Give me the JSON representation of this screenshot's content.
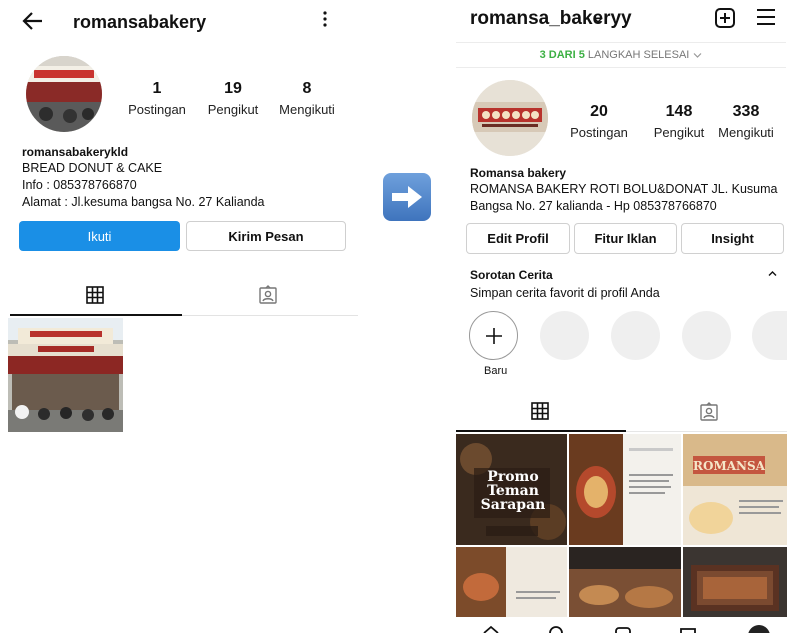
{
  "left_profile": {
    "username": "romansabakery",
    "stats": [
      {
        "count": "1",
        "label": "Postingan"
      },
      {
        "count": "19",
        "label": "Pengikut"
      },
      {
        "count": "8",
        "label": "Mengikuti"
      }
    ],
    "display_name": "romansabakerykld",
    "bio_lines": [
      "BREAD DONUT & CAKE",
      "Info : 085378766870",
      "Alamat : Jl.kesuma bangsa No. 27 Kalianda"
    ],
    "buttons": {
      "follow": "Ikuti",
      "message": "Kirim Pesan"
    }
  },
  "right_profile": {
    "username": "romansa_bakeryy",
    "setup_steps": {
      "done": "3 DARI 5",
      "text": "LANGKAH SELESAI"
    },
    "stats": [
      {
        "count": "20",
        "label": "Postingan"
      },
      {
        "count": "148",
        "label": "Pengikut"
      },
      {
        "count": "338",
        "label": "Mengikuti"
      }
    ],
    "display_name": "Romansa bakery",
    "bio_lines": [
      "ROMANSA BAKERY ROTI BOLU&DONAT JL. Kusuma",
      "Bangsa No. 27 kalianda - Hp 085378766870"
    ],
    "buttons": {
      "edit": "Edit Profil",
      "ads": "Fitur Iklan",
      "insight": "Insight"
    },
    "highlights": {
      "title": "Sorotan Cerita",
      "subtitle": "Simpan cerita favorit di profil Anda",
      "new_label": "Baru"
    },
    "posts": {
      "promo_lines": [
        "Promo",
        "Teman",
        "Sarapan"
      ],
      "shop_sign": "ROMANSA"
    }
  },
  "icons": [
    "back-arrow-icon",
    "more-vertical-icon",
    "grid-icon",
    "tagged-icon",
    "new-post-icon",
    "menu-icon",
    "right-arrow-icon",
    "plus-icon"
  ],
  "colors": {
    "primary_blue": "#1a8fe6",
    "step_green": "#3cb043",
    "arrow_blue": "#4a80c8"
  }
}
